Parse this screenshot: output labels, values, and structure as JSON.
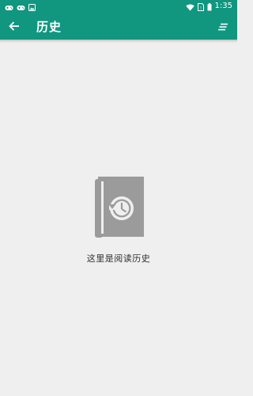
{
  "status_bar": {
    "time": "1:35",
    "icons": [
      "gamepad-icon",
      "gamepad-icon",
      "image-icon",
      "wifi-icon",
      "sim-icon",
      "battery-icon"
    ]
  },
  "app_bar": {
    "title": "历史",
    "back_icon": "arrow-left-icon",
    "menu_icon": "sort-menu-icon"
  },
  "empty_state": {
    "icon": "history-book-icon",
    "message": "这里是阅读历史"
  },
  "colors": {
    "primary": "#119680",
    "background": "#efefef",
    "icon_gray": "#9b9b9b",
    "text": "#2e2e2e"
  }
}
